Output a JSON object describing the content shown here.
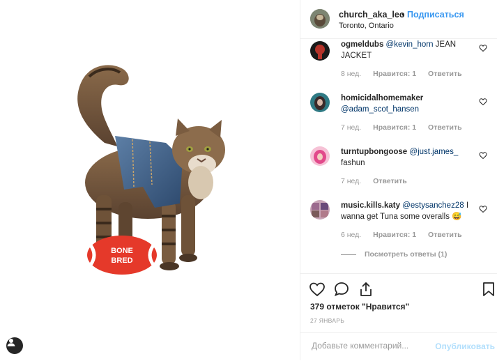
{
  "post": {
    "author": "church_aka_leo",
    "separator": "•",
    "follow_label": "Подписаться",
    "location": "Toronto, Ontario",
    "toy_text_top": "BONE",
    "toy_text_bottom": "BRED"
  },
  "comments": [
    {
      "user": "ogmeldubs",
      "mention": "@kevin_horn",
      "text": " JEAN JACKET",
      "time": "8 нед.",
      "likes": "Нравится: 1",
      "reply": "Ответить",
      "avatar_color": "#b5332a"
    },
    {
      "user": "homicidalhomemaker",
      "mention": "@adam_scot_hansen",
      "text": "",
      "time": "7 нед.",
      "likes": "Нравится: 1",
      "reply": "Ответить",
      "avatar_color": "#2f7a84"
    },
    {
      "user": "turntupbongoose",
      "mention": "@just.james_",
      "text": " fashun",
      "time": "7 нед.",
      "likes": "",
      "reply": "Ответить",
      "avatar_color": "#e24a8b"
    },
    {
      "user": "music.kills.katy",
      "mention": "@estysanchez28",
      "text": " I wanna get Tuna some overalls 😅",
      "time": "6 нед.",
      "likes": "Нравится: 1",
      "reply": "Ответить",
      "avatar_color": "#9b6a8e"
    }
  ],
  "view_replies": "Посмотреть ответы (1)",
  "footer": {
    "likes_text": "379 отметок \"Нравится\"",
    "date": "27 ЯНВАРЬ",
    "comment_placeholder": "Добавьте комментарий...",
    "publish_label": "Опубликовать"
  },
  "icons": [
    "heart-icon",
    "comment-icon",
    "share-icon",
    "bookmark-icon",
    "user-tag-icon"
  ],
  "colors": {
    "link": "#3897f0",
    "mention": "#003569",
    "muted": "#999999"
  }
}
